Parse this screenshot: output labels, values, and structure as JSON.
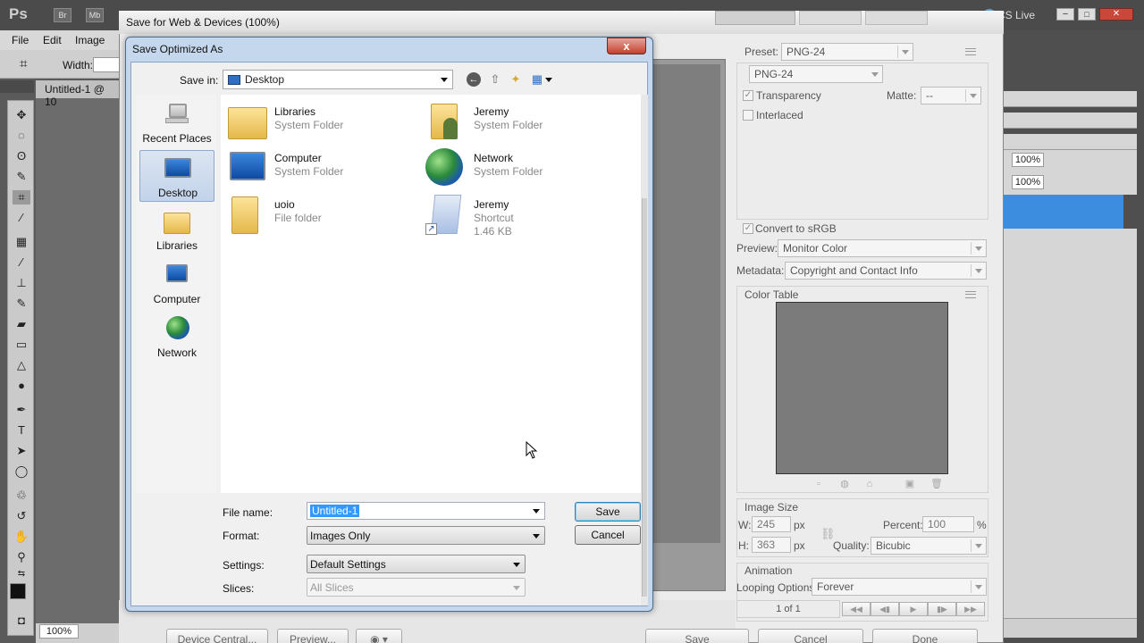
{
  "photoshop": {
    "logo": "Ps",
    "bridge": "Br",
    "minibridge": "Mb",
    "workspace": "CS Live",
    "menu": [
      "File",
      "Edit",
      "Image"
    ],
    "width_label": "Width:",
    "doc_tab": "Untitled-1 @ 10",
    "zoom_status": "100%",
    "right_pct_1": "100%",
    "right_pct_2": "100%"
  },
  "save_for_web": {
    "title": "Save for Web & Devices (100%)",
    "preset_label": "Preset:",
    "preset_value": "PNG-24",
    "format_value": "PNG-24",
    "transparency_label": "Transparency",
    "interlaced_label": "Interlaced",
    "matte_label": "Matte:",
    "matte_value": "--",
    "convert_label": "Convert to sRGB",
    "preview_label": "Preview:",
    "preview_value": "Monitor Color",
    "metadata_label": "Metadata:",
    "metadata_value": "Copyright and Contact Info",
    "color_table_label": "Color Table",
    "image_size_label": "Image Size",
    "w_label": "W:",
    "w_value": "245",
    "h_label": "H:",
    "h_value": "363",
    "px": "px",
    "percent_label": "Percent:",
    "percent_value": "100",
    "percent_sign": "%",
    "quality_label": "Quality:",
    "quality_value": "Bicubic",
    "animation_label": "Animation",
    "looping_label": "Looping Options:",
    "looping_value": "Forever",
    "frame_counter": "1 of 1",
    "bottom_buttons": {
      "device_central": "Device Central...",
      "preview": "Preview...",
      "save": "Save",
      "cancel": "Cancel",
      "done": "Done"
    }
  },
  "dialog": {
    "title": "Save Optimized As",
    "close": "x",
    "save_in_label": "Save in:",
    "save_in_value": "Desktop",
    "places": [
      {
        "label": "Recent Places"
      },
      {
        "label": "Desktop"
      },
      {
        "label": "Libraries"
      },
      {
        "label": "Computer"
      },
      {
        "label": "Network"
      }
    ],
    "files": [
      {
        "name": "Libraries",
        "type": "System Folder",
        "size": ""
      },
      {
        "name": "Jeremy",
        "type": "System Folder",
        "size": ""
      },
      {
        "name": "Computer",
        "type": "System Folder",
        "size": ""
      },
      {
        "name": "Network",
        "type": "System Folder",
        "size": ""
      },
      {
        "name": "uoio",
        "type": "File folder",
        "size": ""
      },
      {
        "name": "Jeremy",
        "type": "Shortcut",
        "size": "1.46 KB"
      }
    ],
    "file_name_label": "File name:",
    "file_name_value": "Untitled-1",
    "format_label": "Format:",
    "format_value": "Images Only",
    "settings_label": "Settings:",
    "settings_value": "Default Settings",
    "slices_label": "Slices:",
    "slices_value": "All Slices",
    "save_button": "Save",
    "cancel_button": "Cancel"
  }
}
